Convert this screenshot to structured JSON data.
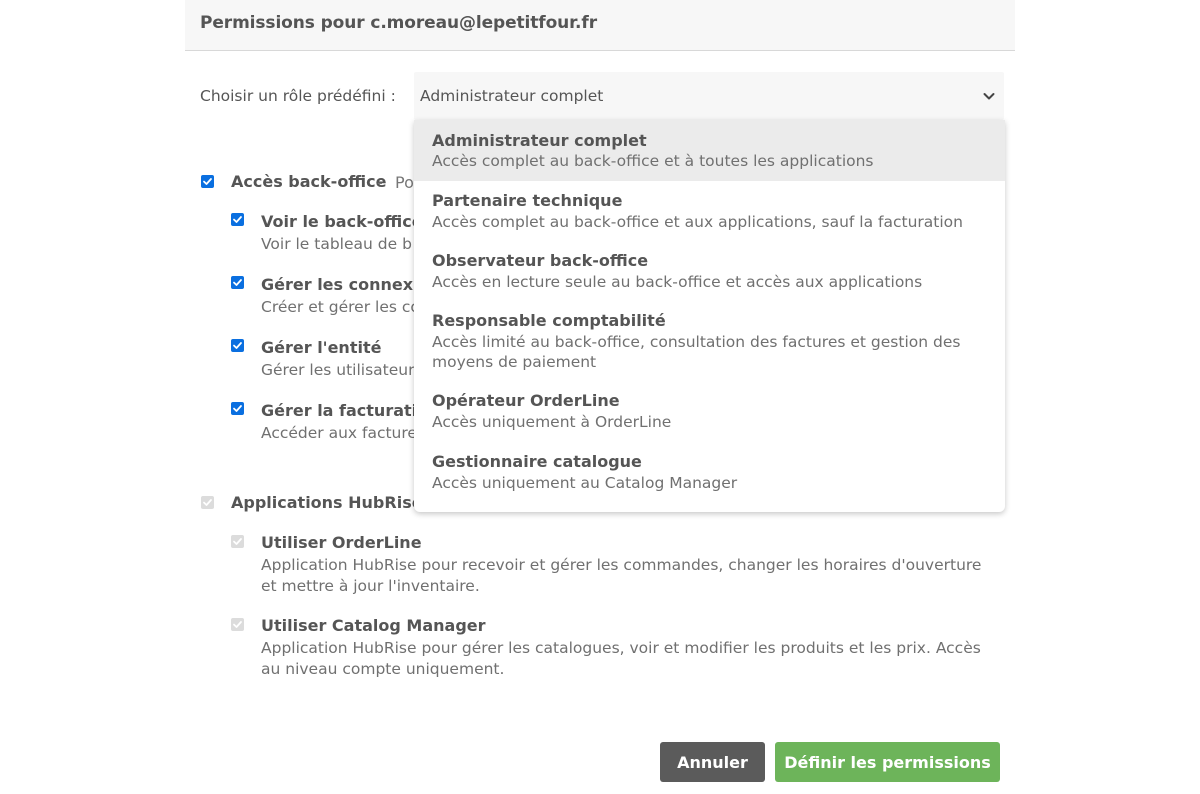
{
  "modal": {
    "title": "Permissions pour c.moreau@lepetitfour.fr"
  },
  "role_selector": {
    "label": "Choisir un rôle prédéfini :",
    "value": "Administrateur complet",
    "options": [
      {
        "title": "Administrateur complet",
        "description": "Accès complet au back-office et à toutes les applications",
        "selected": true
      },
      {
        "title": "Partenaire technique",
        "description": "Accès complet au back-office et aux applications, sauf la facturation"
      },
      {
        "title": "Observateur back-office",
        "description": "Accès en lecture seule au back-office et accès aux applications"
      },
      {
        "title": "Responsable comptabilité",
        "description": "Accès limité au back-office, consultation des factures et gestion des moyens de paiement"
      },
      {
        "title": "Opérateur OrderLine",
        "description": "Accès uniquement à OrderLine"
      },
      {
        "title": "Gestionnaire catalogue",
        "description": "Accès uniquement au Catalog Manager"
      }
    ]
  },
  "backoffice": {
    "title": "Accès back-office",
    "separator": "-",
    "desc_visible": "Po",
    "checked": true,
    "items": [
      {
        "title": "Voir le back-office",
        "description": "Voir le tableau de b",
        "checked": true
      },
      {
        "title": "Gérer les connexio",
        "description": "Créer et gérer les co",
        "checked": true
      },
      {
        "title": "Gérer l'entité",
        "description": "Gérer les utilisateur",
        "checked": true
      },
      {
        "title": "Gérer la facturation",
        "description": "Accéder aux facture",
        "checked": true
      }
    ]
  },
  "apps": {
    "title": "Applications HubRise",
    "checked": true,
    "disabled": true,
    "items": [
      {
        "title": "Utiliser OrderLine",
        "description": "Application HubRise pour recevoir et gérer les commandes, changer les horaires d'ouverture et mettre à jour l'inventaire.",
        "checked": true,
        "disabled": true
      },
      {
        "title": "Utiliser Catalog Manager",
        "description": "Application HubRise pour gérer les catalogues, voir et modifier les produits et les prix. Accès au niveau compte uniquement.",
        "checked": true,
        "disabled": true
      }
    ]
  },
  "buttons": {
    "cancel": "Annuler",
    "confirm": "Définir les permissions"
  },
  "icons": {
    "check": "check-icon",
    "chevron": "chevron-down-icon"
  },
  "colors": {
    "checkbox": "#0a6fe0",
    "checkbox_disabled": "#dcdcdc",
    "confirm": "#6db45a",
    "cancel": "#5b5b5b"
  }
}
